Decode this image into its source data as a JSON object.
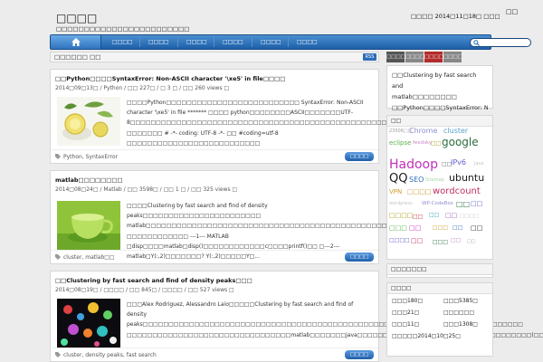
{
  "header": {
    "site_title": "□□□□",
    "tagline": "□□□□□□□□□□□□□□□□□□□□□□□□",
    "date": "□□□□ 2014□11□18□ □□□",
    "top_link": "□□"
  },
  "nav": {
    "items": [
      "□□□□",
      "□□□□",
      "□□□□",
      "□□□□",
      "□□□□",
      "□□□□"
    ]
  },
  "crumb": {
    "text": "□□□□□□ □□",
    "rss": "RSS"
  },
  "posts": [
    {
      "title": "□□Python□□□□SyntaxError: Non-ASCII character '\\xe5' in file□□□□",
      "meta": "2014□09□13□ / Python / □□ 227□ / □ 3 □ / □□ 260 views □",
      "excerpt": "□□□□Python□□□□□□□□□□□□□□□□□□□□□□□□□□ SyntaxError: Non-ASCII character '\\xe5' in file ******* □□□□ python□□□□□□□□ASCII□□□□□□□UTF-8□□□□□□□□□□□□□□□□□□□□□□□□□□□□□□□□□□□□□□□□□□□□□□□□□□□□ □□□□□□□ # -*- coding: UTF-8 -*-    □□  #coding=utf-8 □□□□□□□□□□□□□□□□□□□□□□□□□□",
      "tags": "Python, SyntaxError",
      "more": "□□□□"
    },
    {
      "title": "matlab□□□□□□□□",
      "meta": "2014□08□24□ / Matlab / □□ 3598□ / □□ 1 □ / □□ 325 views □",
      "excerpt": "□□□□Clustering by fast search and find of density peaks□□□□□□□□□□□□□□□□□□□□□□□ matlab□□□□□□□□□□□□□□□□□□□□□□□□□□□□□□□□□□□□□□□□□□□□□□□□□□□□□□□□□□□□ □□□□□□□□□□□□ ---1--- MATLAB □disp□□□□matlab□disp()□□□□□□□□□□□□c□□□□printf()□□ □---2--- matlab□Y(:,2)□□□□□□□? Y(:,2)□□□□□Y□...",
      "tags": "cluster, matlab□□",
      "more": "□□□□"
    },
    {
      "title": "□□Clustering by fast search and find of density peaks□□□",
      "meta": "2014□08□19□ / □□□□ / □□ 845□ / □□□□ / □□ 527 views □",
      "excerpt": "□□□Alex Rodriguez, Alessandro Laio□□□□□Clustering by fast search and find of density peaks□□□□□□□□□□□□□□□□□□□□□□□□□□□□□□□□□□□□□□□□□□□□□□□□□□□□Science□□□□□□□□□□□□□□□□□□ □□□□□□□□□□□□□□□□□□□□□□□□□□□□□□□□matlab□□□□□□□java□□□□□□□□□□□□□□□□□□□□□□□□□□□□□□□□□□(□□.□□...",
      "tags": "cluster, density peaks, fast search",
      "more": "□□□□"
    }
  ],
  "sidebar": {
    "tabs": [
      "□□□□",
      "□□□□",
      "□□□□",
      "□□□□"
    ],
    "recent": [
      "□□Clustering by fast search and",
      "matlab□□□□□□□□",
      "□□Python□□□□SyntaxError: Non-"
    ],
    "tagcloud_title": "□□",
    "tags": [
      {
        "text": "23506□□",
        "color": "#9a9a9a"
      },
      {
        "text": "Chrome",
        "color": "#8f8fd0"
      },
      {
        "text": "cluster",
        "color": "#5aa0d0"
      },
      {
        "text": "eclipse",
        "color": "#58b24a"
      },
      {
        "text": "feedsky",
        "color": "#c889c8"
      },
      {
        "text": "□□",
        "color": "#b0a020"
      },
      {
        "text": "google",
        "color": "#2b6e3f"
      },
      {
        "text": "Hadoop",
        "color": "#c030b8"
      },
      {
        "text": "□□",
        "color": "#666"
      },
      {
        "text": "IPv6",
        "color": "#6060d0"
      },
      {
        "text": "Java",
        "color": "#c4c4c4"
      },
      {
        "text": "QQ",
        "color": "#1a1a1a"
      },
      {
        "text": "SEO",
        "color": "#3070c0"
      },
      {
        "text": "Sitemap",
        "color": "#a8d8a8"
      },
      {
        "text": "ubuntu",
        "color": "#1a1a1a"
      },
      {
        "text": "VPN",
        "color": "#d09a30"
      },
      {
        "text": "□□□□",
        "color": "#d09a30"
      },
      {
        "text": "wordcount",
        "color": "#c03060"
      },
      {
        "text": "wordpress",
        "color": "#c4c4c4"
      },
      {
        "text": "WP-CodeBox",
        "color": "#9090d0"
      },
      {
        "text": "□□",
        "color": "#2b6e3f"
      },
      {
        "text": "□□",
        "color": "#6060d0"
      },
      {
        "text": "□□□□",
        "color": "#b0a020"
      },
      {
        "text": "□□",
        "color": "#c03030"
      },
      {
        "text": "□□",
        "color": "#30a0c0"
      },
      {
        "text": "□□",
        "color": "#9a60c0"
      },
      {
        "text": "□□□□",
        "color": "#c4c4c4"
      },
      {
        "text": "□□□",
        "color": "#58b24a"
      },
      {
        "text": "□□",
        "color": "#c030b8"
      },
      {
        "text": "□□□",
        "color": "#d09a30"
      },
      {
        "text": "□□",
        "color": "#3070c0"
      },
      {
        "text": "□□",
        "color": "#1a1a1a"
      },
      {
        "text": "□□□□",
        "color": "#6060d0"
      },
      {
        "text": "□□",
        "color": "#c03060"
      },
      {
        "text": "□□□",
        "color": "#2b6e3f"
      },
      {
        "text": "□□",
        "color": "#c889c8"
      },
      {
        "text": "□□",
        "color": "#9a9a9a"
      }
    ],
    "box2_title": "□□□□□□□",
    "box3_title": "□□□□",
    "stats": [
      "□□□180□",
      "□□□5385□",
      "□□□21□",
      "□□□□□□",
      "□□□11□",
      "□□□1308□",
      "□□□□□2014□10□25□"
    ]
  },
  "colors": {
    "nav": "#2a6fba",
    "accent_red": "#b32a2a",
    "button": "#2f6fc0"
  }
}
